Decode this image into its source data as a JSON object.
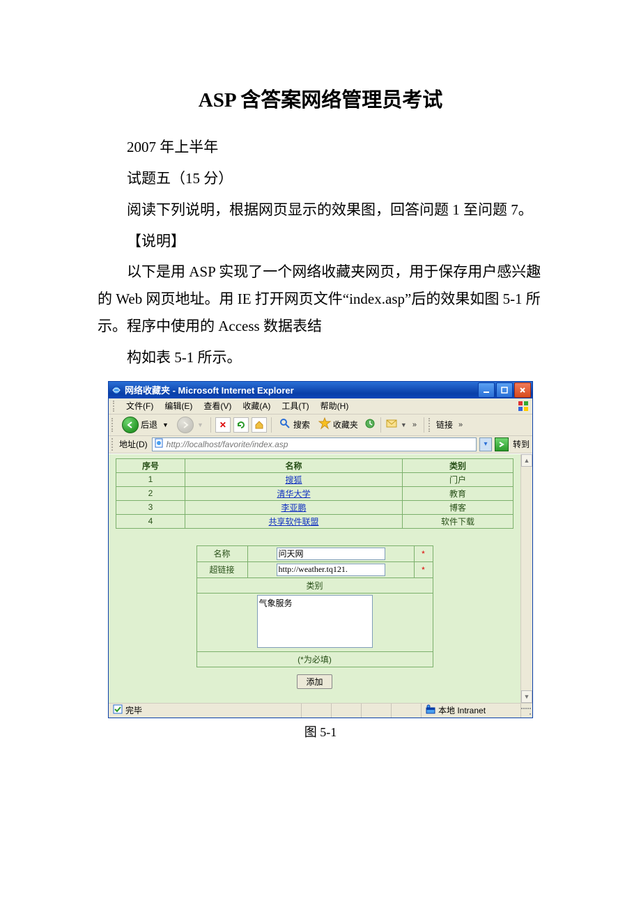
{
  "doc": {
    "title": "ASP 含答案网络管理员考试",
    "line1": "2007 年上半年",
    "line2": "试题五（15 分）",
    "line3": "阅读下列说明，根据网页显示的效果图，回答问题 1 至问题 7。",
    "line4": "【说明】",
    "line5": "以下是用 ASP 实现了一个网络收藏夹网页，用于保存用户感兴趣的 Web 网页地址。用 IE 打开网页文件“index.asp”后的效果如图 5-1 所示。程序中使用的 Access 数据表结",
    "line6": "构如表 5-1 所示。",
    "caption": "图 5-1"
  },
  "browser": {
    "title": "网络收藏夹 - Microsoft Internet Explorer",
    "menu": {
      "file": "文件(F)",
      "edit": "编辑(E)",
      "view": "查看(V)",
      "favorites": "收藏(A)",
      "tools": "工具(T)",
      "help": "帮助(H)"
    },
    "toolbar": {
      "back": "后退",
      "search": "搜索",
      "favorites": "收藏夹",
      "links": "链接"
    },
    "address": {
      "label": "地址(D)",
      "url": "http://localhost/favorite/index.asp",
      "go": "转到"
    },
    "status": {
      "done": "完毕",
      "zone": "本地 Intranet"
    }
  },
  "table": {
    "headers": {
      "idx": "序号",
      "name": "名称",
      "cat": "类别"
    },
    "rows": [
      {
        "idx": "1",
        "name": "搜狐",
        "cat": "门户"
      },
      {
        "idx": "2",
        "name": "清华大学",
        "cat": "教育"
      },
      {
        "idx": "3",
        "name": "李亚鹏",
        "cat": "博客"
      },
      {
        "idx": "4",
        "name": "共享软件联盟",
        "cat": "软件下载"
      }
    ]
  },
  "form": {
    "name_label": "名称",
    "name_value": "问天网",
    "link_label": "超链接",
    "link_value": "http://weather.tq121.",
    "cat_label": "类别",
    "cat_value": "气象服务",
    "required_mark": "*",
    "required_note": "(*为必填)",
    "add_button": "添加"
  }
}
